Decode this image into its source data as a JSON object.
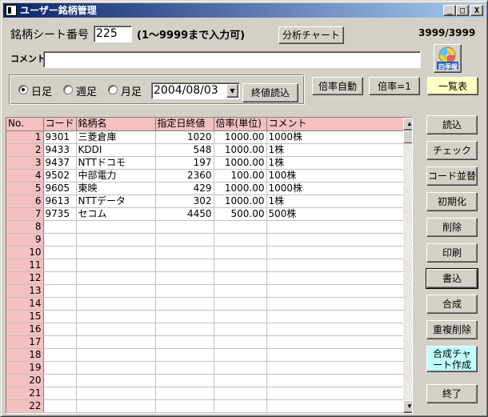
{
  "window": {
    "title": "ユーザー銘柄管理",
    "minimize_label": "_",
    "maximize_label": "□",
    "close_label": "X"
  },
  "header": {
    "sheet_label": "銘柄シート番号",
    "sheet_number": "225",
    "sheet_hint": "(1〜9999まで入力可)",
    "analysis_chart_button": "分析チャート",
    "counter": "3999/3999",
    "comment_label": "コメント",
    "comment_value": "",
    "logo_text": "四季報"
  },
  "period": {
    "daily_label": "日足",
    "weekly_label": "週足",
    "monthly_label": "月足",
    "selected": "daily",
    "date_value": "2004/08/03",
    "dropdown_arrow": "▼",
    "load_close_button": "終値読込"
  },
  "toolbar": {
    "auto_ratio_button": "倍率自動",
    "ratio_one_button": "倍率=1",
    "list_button": "一覧表"
  },
  "grid": {
    "columns": [
      "No.",
      "コード",
      "銘柄名",
      "指定日終値",
      "倍率(単位)",
      "コメント"
    ],
    "rows": [
      {
        "no": "1",
        "code": "9301",
        "name": "三菱倉庫",
        "close": "1020",
        "ratio": "1000.00",
        "comment": "1000株"
      },
      {
        "no": "2",
        "code": "9433",
        "name": "KDDI",
        "close": "548",
        "ratio": "1000.00",
        "comment": "1株"
      },
      {
        "no": "3",
        "code": "9437",
        "name": "NTTドコモ",
        "close": "197",
        "ratio": "1000.00",
        "comment": "1株"
      },
      {
        "no": "4",
        "code": "9502",
        "name": "中部電力",
        "close": "2360",
        "ratio": "100.00",
        "comment": "100株"
      },
      {
        "no": "5",
        "code": "9605",
        "name": "東映",
        "close": "429",
        "ratio": "1000.00",
        "comment": "1000株"
      },
      {
        "no": "6",
        "code": "9613",
        "name": "NTTデータ",
        "close": "302",
        "ratio": "1000.00",
        "comment": "1株"
      },
      {
        "no": "7",
        "code": "9735",
        "name": "セコム",
        "close": "4450",
        "ratio": "500.00",
        "comment": "500株"
      },
      {
        "no": "8",
        "code": "",
        "name": "",
        "close": "",
        "ratio": "",
        "comment": ""
      },
      {
        "no": "9",
        "code": "",
        "name": "",
        "close": "",
        "ratio": "",
        "comment": ""
      },
      {
        "no": "10",
        "code": "",
        "name": "",
        "close": "",
        "ratio": "",
        "comment": ""
      },
      {
        "no": "11",
        "code": "",
        "name": "",
        "close": "",
        "ratio": "",
        "comment": ""
      },
      {
        "no": "12",
        "code": "",
        "name": "",
        "close": "",
        "ratio": "",
        "comment": ""
      },
      {
        "no": "13",
        "code": "",
        "name": "",
        "close": "",
        "ratio": "",
        "comment": ""
      },
      {
        "no": "14",
        "code": "",
        "name": "",
        "close": "",
        "ratio": "",
        "comment": ""
      },
      {
        "no": "15",
        "code": "",
        "name": "",
        "close": "",
        "ratio": "",
        "comment": ""
      },
      {
        "no": "16",
        "code": "",
        "name": "",
        "close": "",
        "ratio": "",
        "comment": ""
      },
      {
        "no": "17",
        "code": "",
        "name": "",
        "close": "",
        "ratio": "",
        "comment": ""
      },
      {
        "no": "18",
        "code": "",
        "name": "",
        "close": "",
        "ratio": "",
        "comment": ""
      },
      {
        "no": "19",
        "code": "",
        "name": "",
        "close": "",
        "ratio": "",
        "comment": ""
      },
      {
        "no": "20",
        "code": "",
        "name": "",
        "close": "",
        "ratio": "",
        "comment": ""
      },
      {
        "no": "21",
        "code": "",
        "name": "",
        "close": "",
        "ratio": "",
        "comment": ""
      },
      {
        "no": "22",
        "code": "",
        "name": "",
        "close": "",
        "ratio": "",
        "comment": ""
      }
    ],
    "scroll_up": "▲",
    "scroll_down": "▼"
  },
  "side_buttons": {
    "read": "読込",
    "check": "チェック",
    "sort_code": "コード並替",
    "initialize": "初期化",
    "delete": "削除",
    "print": "印刷",
    "write": "書込",
    "merge": "合成",
    "dedupe": "重複削除",
    "merge_chart": "合成チャート作成",
    "exit": "終了"
  },
  "colors": {
    "title_start": "#0a246a",
    "title_end": "#a6caf0",
    "header_pink": "#f4c0c0",
    "list_button_bg": "#ffffc0",
    "merge_chart_bg": "#c0ffff"
  }
}
